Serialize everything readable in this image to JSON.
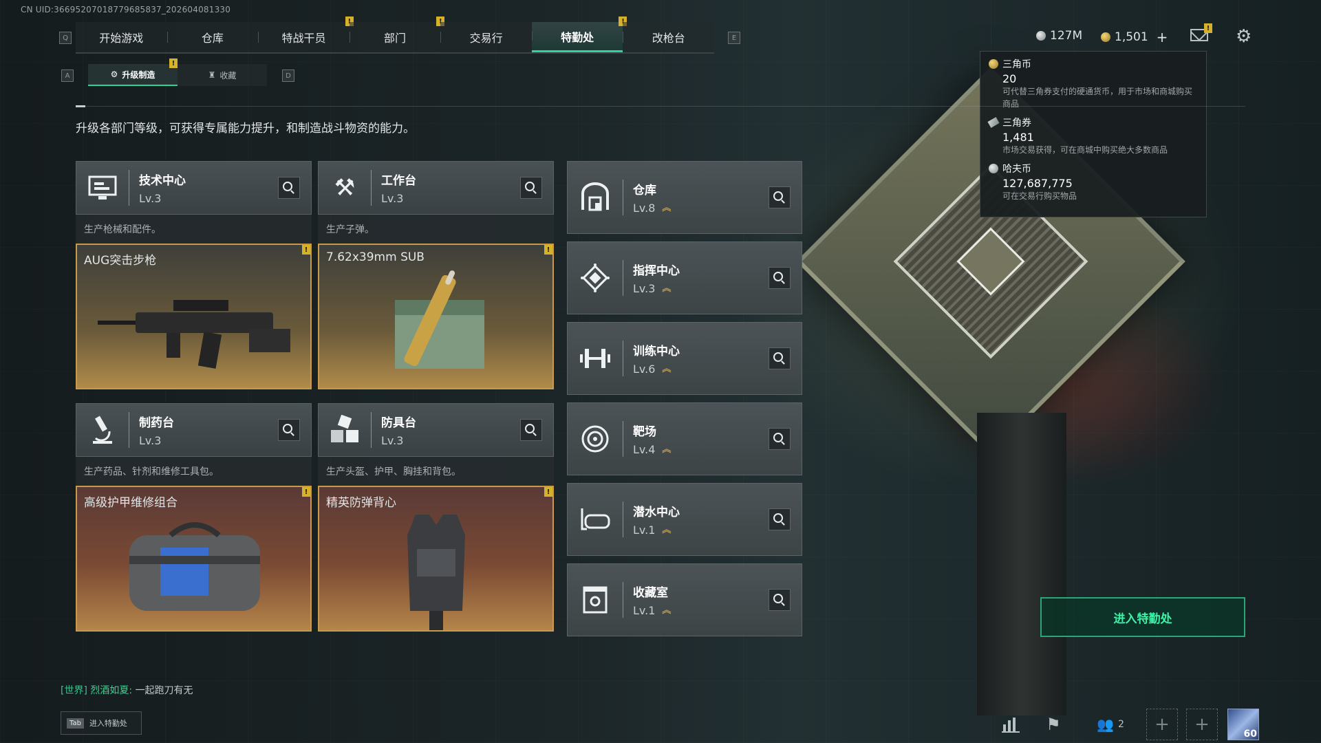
{
  "uid": "CN UID:3669520701877968583​7_202604081330",
  "nav": {
    "key_left": "Q",
    "key_right": "E",
    "tabs": [
      {
        "label": "开始游戏",
        "flag": false
      },
      {
        "label": "仓库",
        "flag": false
      },
      {
        "label": "特战干员",
        "flag": true
      },
      {
        "label": "部门",
        "flag": true
      },
      {
        "label": "交易行",
        "flag": false
      },
      {
        "label": "特勤处",
        "flag": true,
        "active": true
      },
      {
        "label": "改枪台",
        "flag": false
      }
    ]
  },
  "subnav": {
    "key_left": "A",
    "key_right": "D",
    "tabs": [
      {
        "label": "升级制造",
        "active": true
      },
      {
        "label": "收藏",
        "active": false
      }
    ]
  },
  "topbar": {
    "silver_amount": "127M",
    "gold_amount": "1,501",
    "gold_plus": "+",
    "flag_mark": "!"
  },
  "tooltip": {
    "items": [
      {
        "name": "三角币",
        "value": "20",
        "desc": "可代替三角券支付的硬通货币，用于市场和商城购买商品"
      },
      {
        "name": "三角券",
        "value": "1,481",
        "desc": "市场交易获得，可在商城中购买绝大多数商品"
      },
      {
        "name": "哈夫币",
        "value": "127,687,775",
        "desc": "可在交易行购买物品"
      }
    ]
  },
  "intro": "升级各部门等级，可获得专属能力提升，和制造战斗物资的能力。",
  "benches": [
    {
      "name": "技术中心",
      "level": "Lv.3",
      "desc": "生产枪械和配件。",
      "item": "AUG突击步枪",
      "icon": "monitor-icon"
    },
    {
      "name": "工作台",
      "level": "Lv.3",
      "desc": "生产子弹。",
      "item": "7.62x39mm SUB",
      "icon": "hammer-wrench-icon"
    },
    {
      "name": "制药台",
      "level": "Lv.3",
      "desc": "生产药品、针剂和维修工具包。",
      "item": "高级护甲维修组合",
      "icon": "microscope-icon"
    },
    {
      "name": "防具台",
      "level": "Lv.3",
      "desc": "生产头盔、护甲、胸挂和背包。",
      "item": "精英防弹背心",
      "icon": "boxes-icon"
    }
  ],
  "departments": [
    {
      "name": "仓库",
      "level": "Lv.8",
      "icon": "warehouse-icon"
    },
    {
      "name": "指挥中心",
      "level": "Lv.3",
      "icon": "command-icon"
    },
    {
      "name": "训练中心",
      "level": "Lv.6",
      "icon": "dumbbell-icon"
    },
    {
      "name": "靶场",
      "level": "Lv.4",
      "icon": "target-icon"
    },
    {
      "name": "潜水中心",
      "level": "Lv.1",
      "icon": "diving-mask-icon"
    },
    {
      "name": "收藏室",
      "level": "Lv.1",
      "icon": "collection-icon"
    }
  ],
  "enter_button": "进入特勤处",
  "chat": {
    "channel": "[世界]",
    "sender": "烈酒如夏:",
    "message": "一起跑刀有无"
  },
  "tab_hint": {
    "key": "Tab",
    "label": "进入特勤处"
  },
  "bottom": {
    "friends_count": "2",
    "avatar_level": "60"
  },
  "colors": {
    "accent": "#2fd49a",
    "flag": "#d6b22c",
    "item_border": "#c89b4c"
  }
}
